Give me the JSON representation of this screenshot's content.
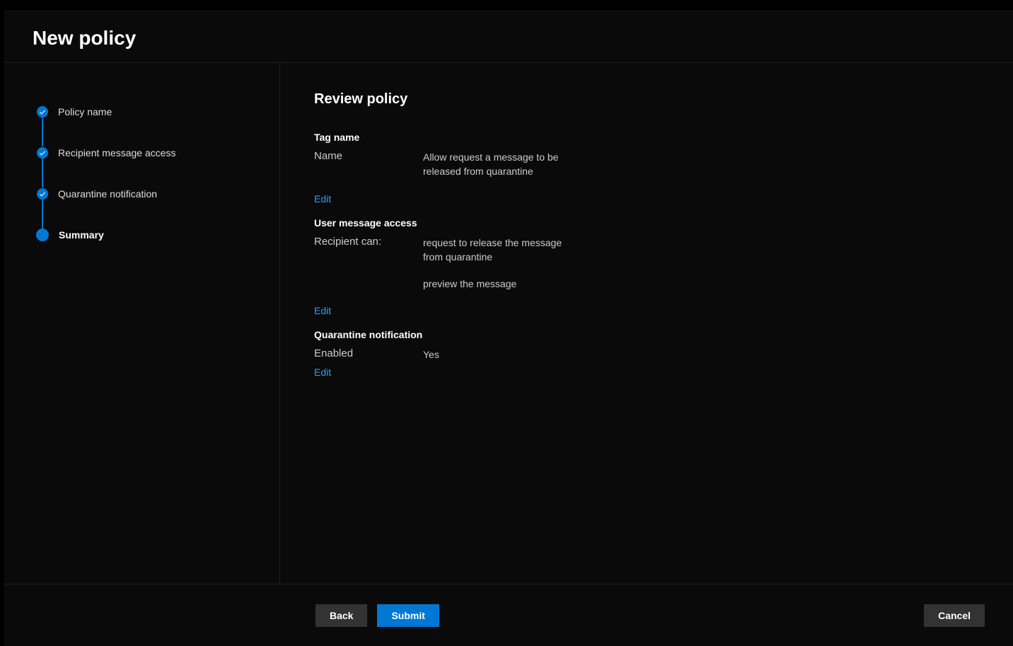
{
  "header": {
    "title": "New policy"
  },
  "steps": [
    {
      "label": "Policy name",
      "completed": true,
      "current": false
    },
    {
      "label": "Recipient message access",
      "completed": true,
      "current": false
    },
    {
      "label": "Quarantine notification",
      "completed": true,
      "current": false
    },
    {
      "label": "Summary",
      "completed": false,
      "current": true
    }
  ],
  "content": {
    "title": "Review policy",
    "sections": {
      "tag_name": {
        "heading": "Tag name",
        "label": "Name",
        "value": "Allow request a message to be released from quarantine",
        "edit": "Edit"
      },
      "user_access": {
        "heading": "User message access",
        "label": "Recipient can:",
        "value1": "request to release the message from quarantine",
        "value2": "preview the message",
        "edit": "Edit"
      },
      "notification": {
        "heading": "Quarantine notification",
        "label": "Enabled",
        "value": "Yes",
        "edit": "Edit"
      }
    }
  },
  "footer": {
    "back": "Back",
    "submit": "Submit",
    "cancel": "Cancel"
  }
}
